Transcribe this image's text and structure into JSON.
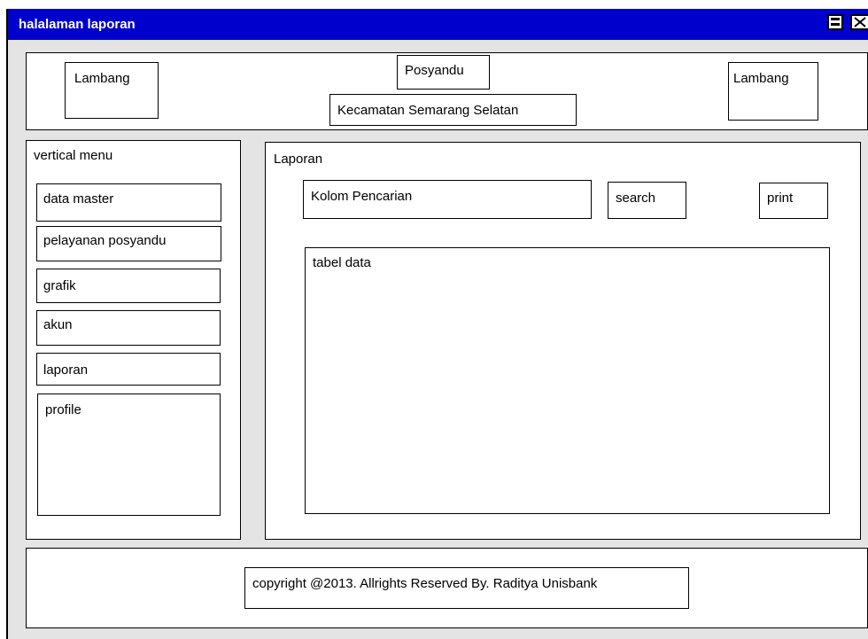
{
  "window": {
    "title": "halalaman laporan"
  },
  "header": {
    "logo_left": "Lambang",
    "logo_right": "Lambang",
    "app_name": "Posyandu",
    "subtitle": "Kecamatan Semarang Selatan"
  },
  "sidebar": {
    "title": "vertical menu",
    "items": [
      {
        "label": "data master"
      },
      {
        "label": "pelayanan posyandu"
      },
      {
        "label": "grafik"
      },
      {
        "label": "akun"
      },
      {
        "label": "laporan"
      }
    ],
    "profile_label": "profile"
  },
  "main": {
    "title": "Laporan",
    "search_field": "Kolom Pencarian",
    "search_button": "search",
    "print_button": "print",
    "table_label": "tabel data"
  },
  "footer": {
    "copyright": "copyright @2013. Allrights Reserved By. Raditya Unisbank"
  }
}
